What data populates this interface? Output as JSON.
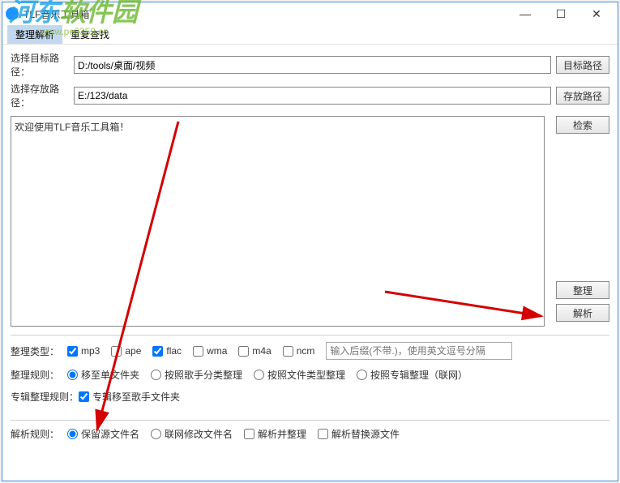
{
  "title": "TLF音乐工具箱",
  "menubar": {
    "item1": "整理解析",
    "item2": "重复查找"
  },
  "rows": {
    "target_label": "选择目标路径：",
    "target_value": "D:/tools/桌面/视频",
    "target_btn": "目标路径",
    "save_label": "选择存放路径：",
    "save_value": "E:/123/data",
    "save_btn": "存放路径"
  },
  "log": "欢迎使用TLF音乐工具箱！",
  "side": {
    "search": "检索",
    "organize": "整理",
    "parse": "解析"
  },
  "type_row": {
    "label": "整理类型：",
    "mp3": "mp3",
    "ape": "ape",
    "flac": "flac",
    "wma": "wma",
    "m4a": "m4a",
    "ncm": "ncm",
    "ext_placeholder": "输入后缀(不带.)，使用英文逗号分隔"
  },
  "rule_row": {
    "label": "整理规则：",
    "r1": "移至单文件夹",
    "r2": "按照歌手分类整理",
    "r3": "按照文件类型整理",
    "r4": "按照专辑整理（联网）"
  },
  "album_rule": {
    "label": "专辑整理规则：",
    "c1": "专辑移至歌手文件夹"
  },
  "parse_rule": {
    "label": "解析规则：",
    "r1": "保留源文件名",
    "r2": "联网修改文件名",
    "c1": "解析并整理",
    "c2": "解析替换源文件"
  },
  "watermark": {
    "line1a": "河东",
    "line1b": "软件园",
    "line2": "www.pc0359.cn"
  }
}
